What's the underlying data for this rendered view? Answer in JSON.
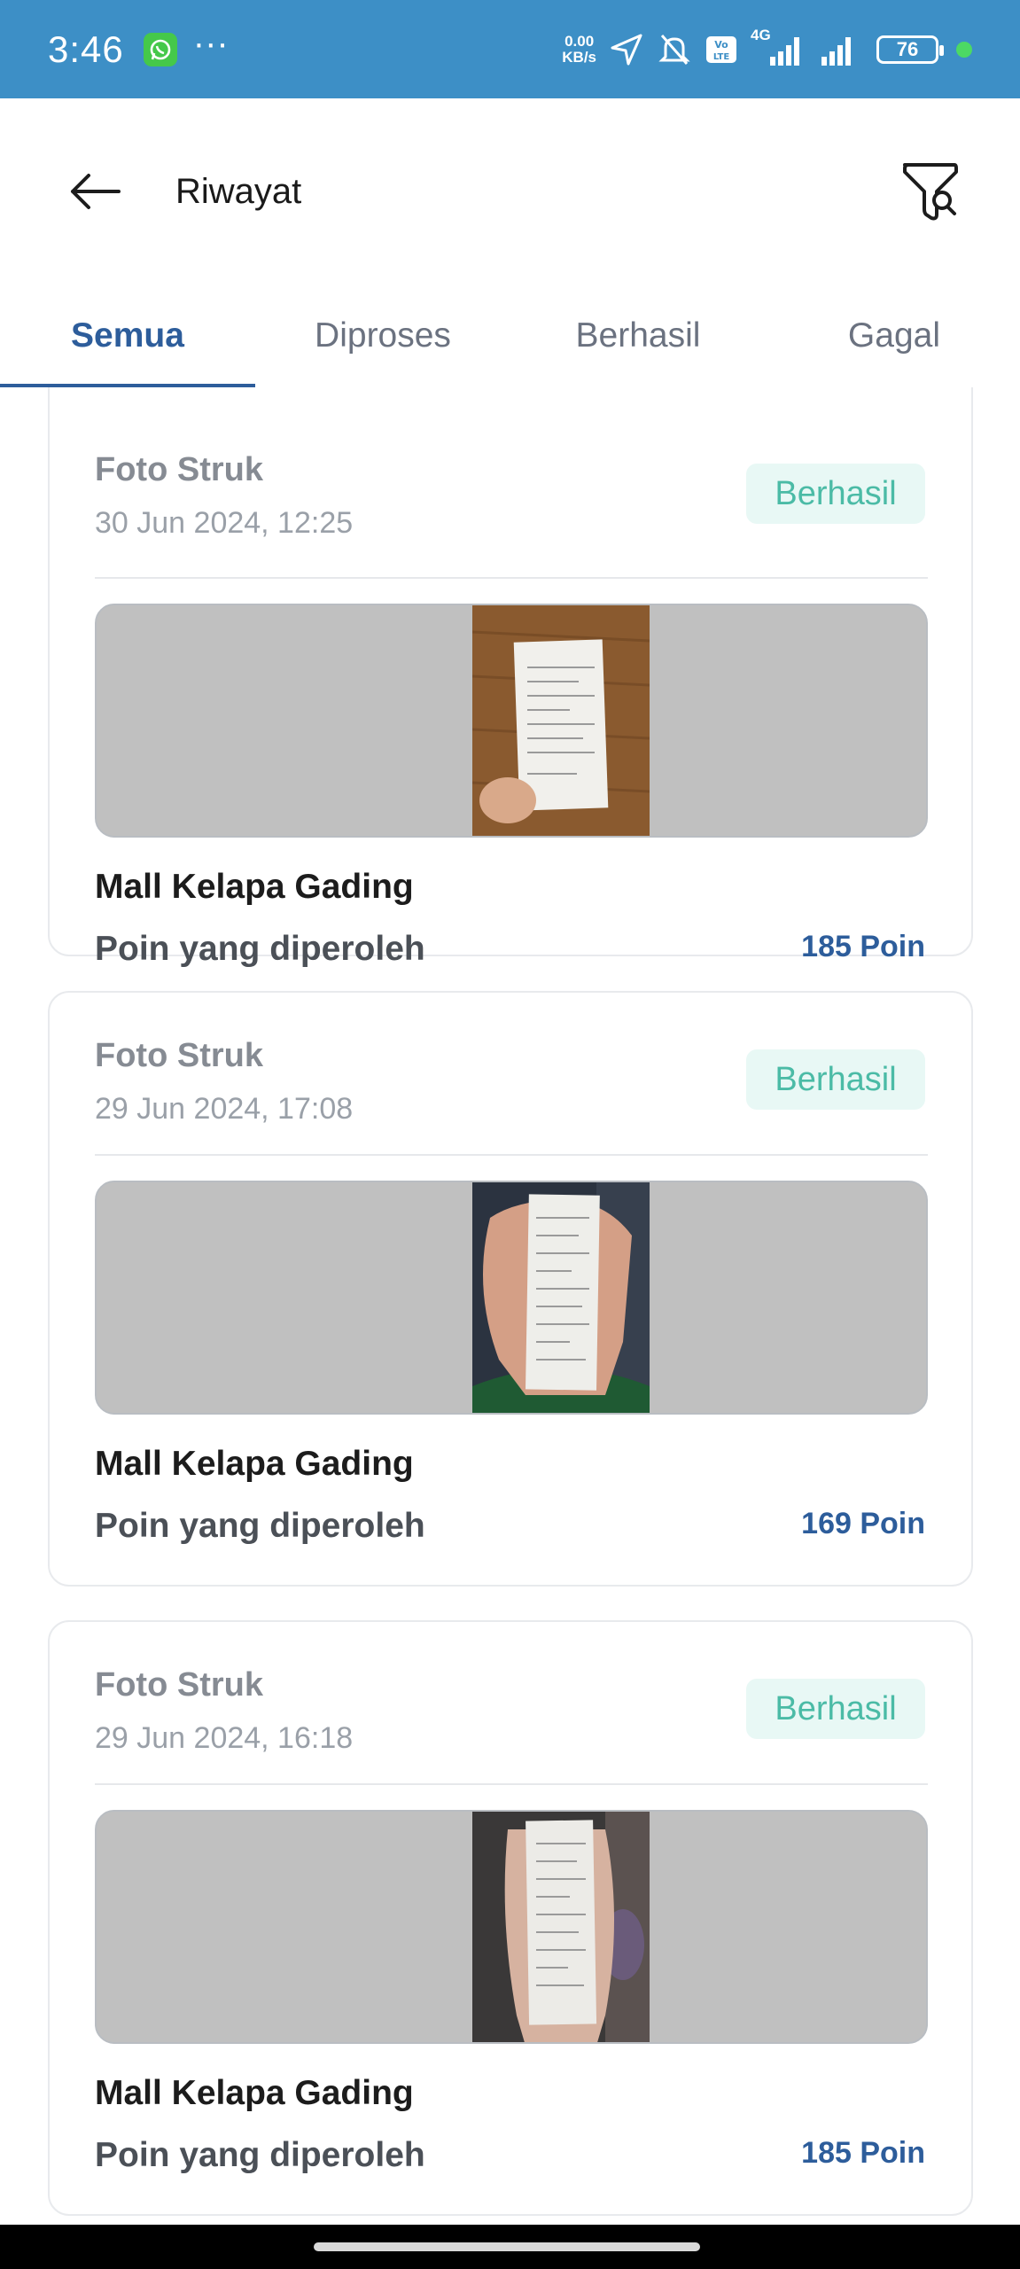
{
  "status_bar": {
    "time": "3:46",
    "more": "···",
    "speed_value": "0.00",
    "speed_unit": "KB/s",
    "network": "4G",
    "battery": "76",
    "icons": [
      "whatsapp-icon",
      "location-arrow-icon",
      "bell-off-icon",
      "volte-icon",
      "signal-icon",
      "signal-icon",
      "battery-icon"
    ]
  },
  "header": {
    "title": "Riwayat",
    "back_icon": "arrow-left-icon",
    "filter_icon": "filter-search-icon"
  },
  "tabs": [
    {
      "label": "Semua",
      "active": true
    },
    {
      "label": "Diproses",
      "active": false
    },
    {
      "label": "Berhasil",
      "active": false
    },
    {
      "label": "Gagal",
      "active": false
    }
  ],
  "transactions": [
    {
      "type": "Foto Struk",
      "date": "30 Jun 2024, 12:25",
      "status": "Berhasil",
      "store": "Mall Kelapa Gading",
      "points_label": "Poin yang diperoleh",
      "points": "185 Poin"
    },
    {
      "type": "Foto Struk",
      "date": "29 Jun 2024, 17:08",
      "status": "Berhasil",
      "store": "Mall Kelapa Gading",
      "points_label": "Poin yang diperoleh",
      "points": "169 Poin"
    },
    {
      "type": "Foto Struk",
      "date": "29 Jun 2024, 16:18",
      "status": "Berhasil",
      "store": "Mall Kelapa Gading",
      "points_label": "Poin yang diperoleh",
      "points": "185 Poin"
    }
  ],
  "colors": {
    "status_bar": "#3d8fc6",
    "accent": "#2d5d9b",
    "success_text": "#4bbba6",
    "success_bg": "#e8f8f5"
  }
}
